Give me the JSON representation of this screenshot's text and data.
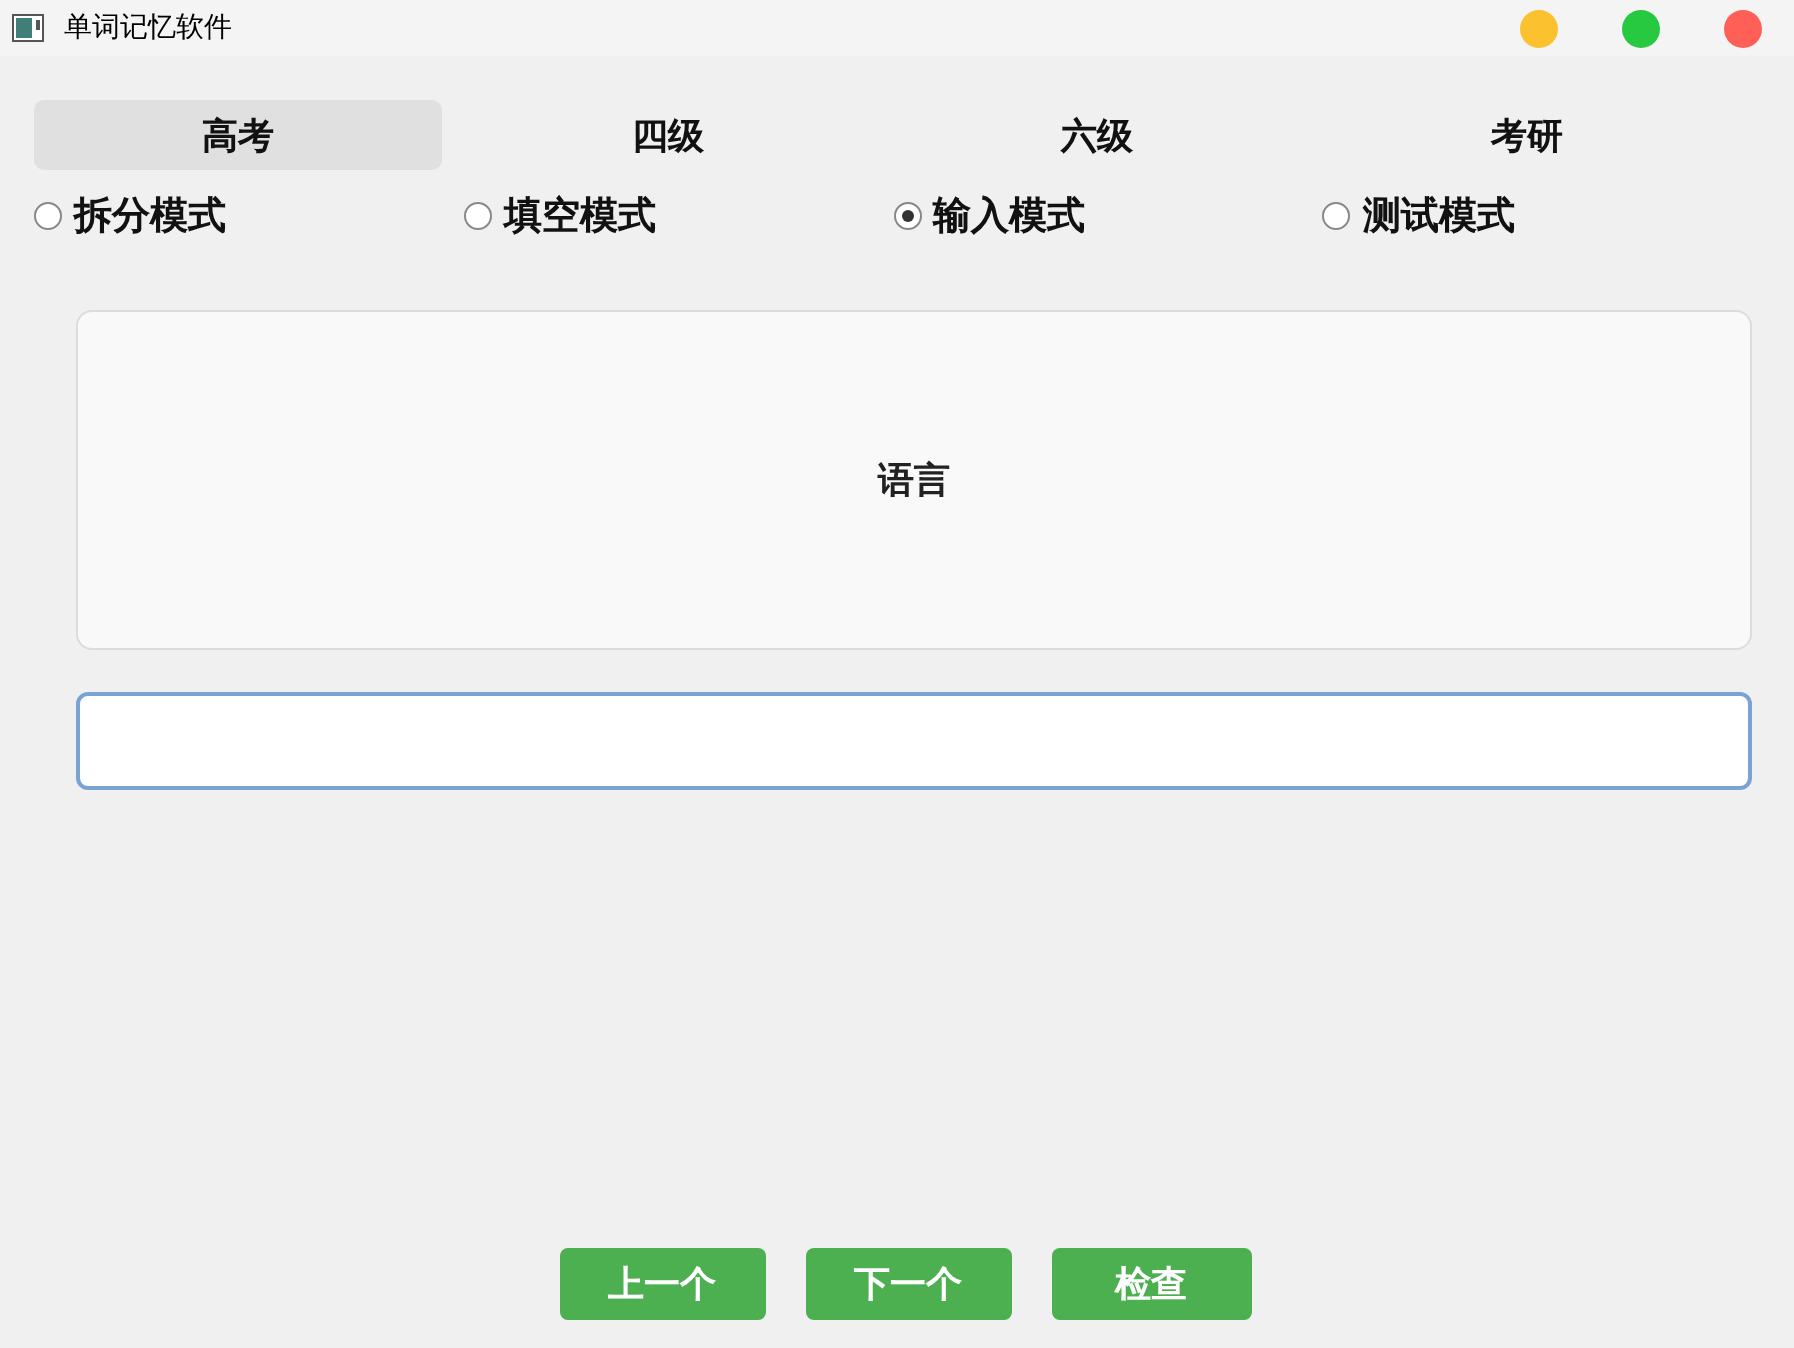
{
  "window": {
    "title": "单词记忆软件"
  },
  "tabs": [
    {
      "label": "高考",
      "selected": true
    },
    {
      "label": "四级",
      "selected": false
    },
    {
      "label": "六级",
      "selected": false
    },
    {
      "label": "考研",
      "selected": false
    }
  ],
  "modes": [
    {
      "label": "拆分模式",
      "selected": false
    },
    {
      "label": "填空模式",
      "selected": false
    },
    {
      "label": "输入模式",
      "selected": true
    },
    {
      "label": "测试模式",
      "selected": false
    }
  ],
  "card": {
    "text": "语言"
  },
  "buttons": [
    "上一个",
    "下一个",
    "检查"
  ]
}
